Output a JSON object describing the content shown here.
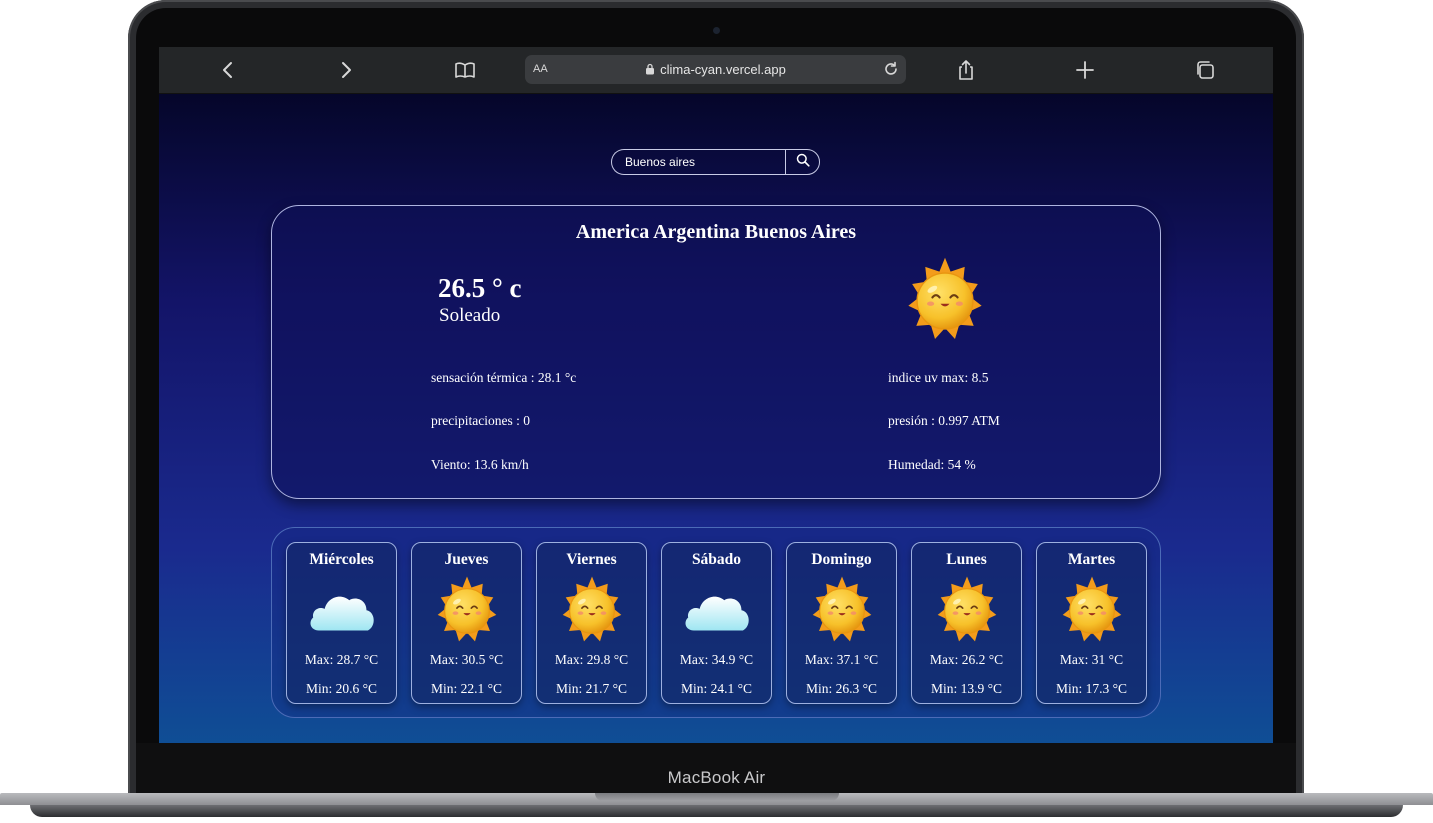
{
  "device": {
    "label": "MacBook Air"
  },
  "browser": {
    "text_size_label": "AA",
    "url": "clima-cyan.vercel.app",
    "icons": [
      "back-icon",
      "forward-icon",
      "bookmarks-icon",
      "lock-icon",
      "reload-icon",
      "share-icon",
      "new-tab-icon",
      "tabs-icon"
    ]
  },
  "search": {
    "value": "Buenos aires",
    "icon": "search-icon"
  },
  "current": {
    "city": "America Argentina Buenos Aires",
    "temperature": "26.5 ° c",
    "condition": "Soleado",
    "icon": "sun-icon",
    "stats": {
      "feels_like": "sensación térmica : 28.1 °c",
      "precipitation": "precipitaciones : 0",
      "wind": "Viento: 13.6 km/h",
      "uv": "indice uv max: 8.5",
      "pressure": "presión : 0.997 ATM",
      "humidity": "Humedad: 54 %"
    }
  },
  "forecast": [
    {
      "day": "Miércoles",
      "icon": "cloud-icon",
      "max": "Max: 28.7 °C",
      "min": "Min: 20.6 °C"
    },
    {
      "day": "Jueves",
      "icon": "sun-icon",
      "max": "Max: 30.5 °C",
      "min": "Min: 22.1 °C"
    },
    {
      "day": "Viernes",
      "icon": "sun-icon",
      "max": "Max: 29.8 °C",
      "min": "Min: 21.7 °C"
    },
    {
      "day": "Sábado",
      "icon": "cloud-icon",
      "max": "Max: 34.9 °C",
      "min": "Min: 24.1 °C"
    },
    {
      "day": "Domingo",
      "icon": "sun-icon",
      "max": "Max: 37.1 °C",
      "min": "Min: 26.3 °C"
    },
    {
      "day": "Lunes",
      "icon": "sun-icon",
      "max": "Max: 26.2 °C",
      "min": "Min: 13.9 °C"
    },
    {
      "day": "Martes",
      "icon": "sun-icon",
      "max": "Max: 31 °C",
      "min": "Min: 17.3 °C"
    }
  ],
  "colors": {
    "page_top": "#05062a",
    "page_bottom": "#0f4e95",
    "sun": "#f7b526",
    "cloud": "#e6f7ff"
  }
}
